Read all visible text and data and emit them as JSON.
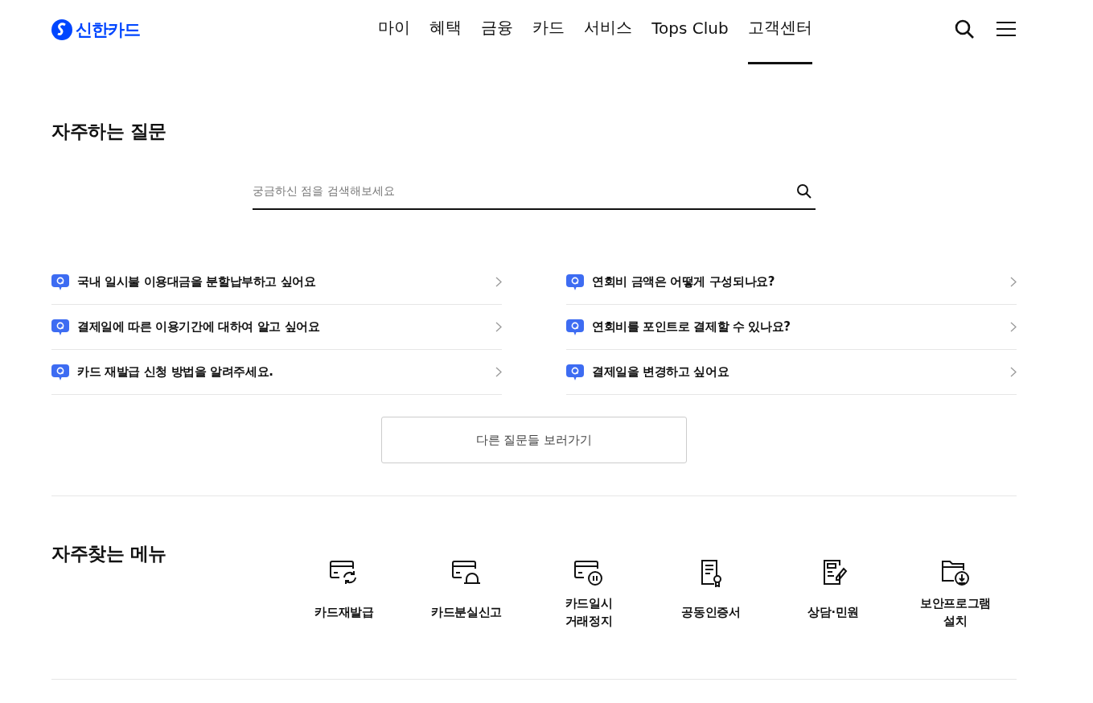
{
  "header": {
    "logo": "신한카드",
    "nav": [
      {
        "label": "마이",
        "selected": false
      },
      {
        "label": "혜택",
        "selected": false
      },
      {
        "label": "금융",
        "selected": false
      },
      {
        "label": "카드",
        "selected": false
      },
      {
        "label": "서비스",
        "selected": false
      },
      {
        "label": "Tops Club",
        "selected": false
      },
      {
        "label": "고객센터",
        "selected": true
      }
    ]
  },
  "faq": {
    "title": "자주하는 질문",
    "search": {
      "placeholder": "궁금하신 점을 검색해보세요"
    },
    "questions": [
      [
        {
          "text": "국내 일시불 이용대금을 분할납부하고 싶어요"
        },
        {
          "text": "결제일에 따른 이용기간에 대하여 알고 싶어요"
        },
        {
          "text": "카드 재발급 신청 방법을 알려주세요."
        }
      ],
      [
        {
          "text": "연회비 금액은 어떻게 구성되나요?"
        },
        {
          "text": "연회비를 포인트로 결제할 수 있나요?"
        },
        {
          "text": "결제일을 변경하고 싶어요"
        }
      ]
    ],
    "more_button": "다른 질문들 보러가기"
  },
  "menu": {
    "title": "자주찾는 메뉴",
    "items": [
      {
        "kind": "reissue",
        "lines": [
          "카드재발급"
        ]
      },
      {
        "kind": "lost",
        "lines": [
          "카드분실신고"
        ]
      },
      {
        "kind": "pause",
        "lines": [
          "카드일시",
          "거래정지"
        ]
      },
      {
        "kind": "certificate",
        "lines": [
          "공동인증서"
        ]
      },
      {
        "kind": "consult",
        "lines": [
          "상담·민원"
        ]
      },
      {
        "kind": "download",
        "lines": [
          "보안프로그램",
          "설치"
        ]
      }
    ]
  }
}
